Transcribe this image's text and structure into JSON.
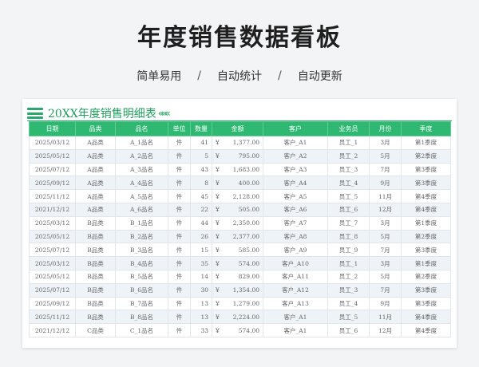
{
  "page": {
    "title": "年度销售数据看板",
    "features": [
      "简单易用",
      "自动统计",
      "自动更新"
    ],
    "separator": "/"
  },
  "sheet": {
    "title": "20XX年度销售明细表",
    "chevrons": "«««",
    "accent_color": "#2eb872",
    "icon": "menu-icon",
    "columns": [
      "日期",
      "品类",
      "品名",
      "单位",
      "数量",
      "金额",
      "客户",
      "业务员",
      "月份",
      "季度"
    ],
    "rows": [
      [
        "2025/03/12",
        "A品类",
        "A_1品名",
        "件",
        "41",
        "¥",
        "1,377.00",
        "客户_A1",
        "员工_1",
        "3月",
        "第1季度"
      ],
      [
        "2025/05/12",
        "A品类",
        "A_2品名",
        "件",
        "5",
        "¥",
        "795.00",
        "客户_A2",
        "员工_2",
        "5月",
        "第2季度"
      ],
      [
        "2025/07/12",
        "A品类",
        "A_3品名",
        "件",
        "43",
        "¥",
        "1,683.00",
        "客户_A3",
        "员工_3",
        "7月",
        "第3季度"
      ],
      [
        "2025/09/12",
        "A品类",
        "A_4品名",
        "件",
        "8",
        "¥",
        "400.00",
        "客户_A4",
        "员工_4",
        "9月",
        "第3季度"
      ],
      [
        "2025/11/12",
        "A品类",
        "A_5品名",
        "件",
        "45",
        "¥",
        "2,128.00",
        "客户_A5",
        "员工_5",
        "11月",
        "第4季度"
      ],
      [
        "2021/12/12",
        "A品类",
        "A_6品名",
        "件",
        "22",
        "¥",
        "505.00",
        "客户_A6",
        "员工_6",
        "12月",
        "第4季度"
      ],
      [
        "2025/03/12",
        "B品类",
        "B_1品名",
        "件",
        "44",
        "¥",
        "2,350.00",
        "客户_A7",
        "员工_7",
        "3月",
        "第1季度"
      ],
      [
        "2025/05/12",
        "B品类",
        "B_2品名",
        "件",
        "26",
        "¥",
        "2,377.00",
        "客户_A8",
        "员工_8",
        "5月",
        "第2季度"
      ],
      [
        "2025/07/12",
        "B品类",
        "B_3品名",
        "件",
        "15",
        "¥",
        "585.00",
        "客户_A9",
        "员工_9",
        "7月",
        "第3季度"
      ],
      [
        "2025/03/12",
        "B品类",
        "B_4品名",
        "件",
        "35",
        "¥",
        "574.00",
        "客户_A10",
        "员工_1",
        "3月",
        "第1季度"
      ],
      [
        "2025/05/12",
        "B品类",
        "B_5品名",
        "件",
        "14",
        "¥",
        "829.00",
        "客户_A11",
        "员工_2",
        "5月",
        "第2季度"
      ],
      [
        "2025/07/12",
        "B品类",
        "B_6品名",
        "件",
        "30",
        "¥",
        "1,354.00",
        "客户_A12",
        "员工_3",
        "7月",
        "第3季度"
      ],
      [
        "2025/09/12",
        "B品类",
        "B_7品名",
        "件",
        "13",
        "¥",
        "1,279.00",
        "客户_A13",
        "员工_4",
        "9月",
        "第3季度"
      ],
      [
        "2025/11/12",
        "B品类",
        "B_8品名",
        "件",
        "13",
        "¥",
        "2,224.00",
        "客户_A1",
        "员工_5",
        "11月",
        "第4季度"
      ],
      [
        "2021/12/12",
        "C品类",
        "C_1品名",
        "件",
        "33",
        "¥",
        "574.00",
        "客户_A1",
        "员工_6",
        "12月",
        "第4季度"
      ]
    ]
  }
}
